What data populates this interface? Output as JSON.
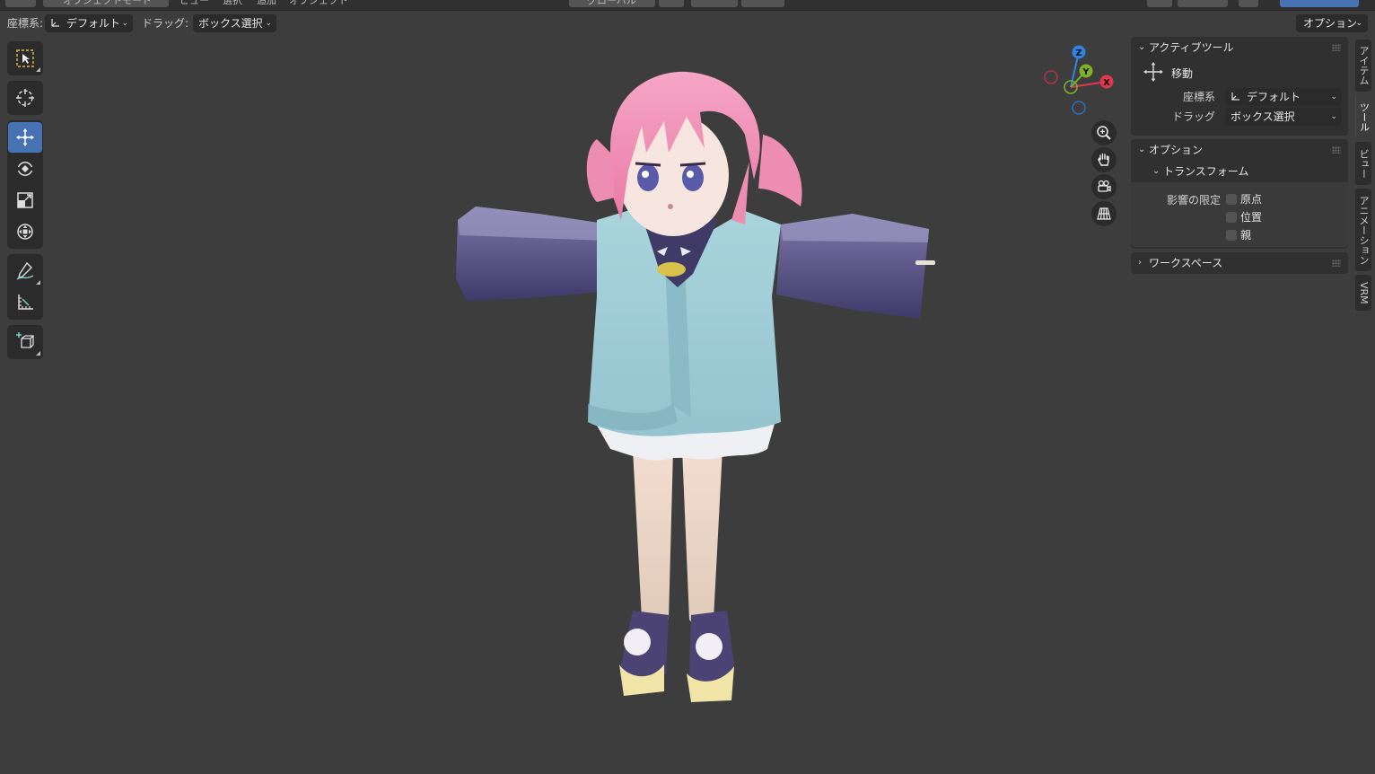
{
  "top_strip": {
    "mode_dropdown": "オブジェクトモード",
    "menu_view": "ビュー",
    "menu_select": "選択",
    "menu_add": "追加",
    "menu_object": "オブジェクト",
    "transform_orientation": "グローバル"
  },
  "tool_header": {
    "coord_label": "座標系:",
    "coord_value": "デフォルト",
    "drag_label": "ドラッグ:",
    "drag_value": "ボックス選択",
    "options_button": "オプション"
  },
  "toolbar": {
    "tools": [
      {
        "name": "select-box",
        "icon": "select-box-icon"
      },
      {
        "name": "cursor",
        "icon": "cursor-icon"
      },
      {
        "name": "move",
        "icon": "move-icon",
        "active": true
      },
      {
        "name": "rotate",
        "icon": "rotate-icon"
      },
      {
        "name": "scale",
        "icon": "scale-icon"
      },
      {
        "name": "transform",
        "icon": "transform-icon"
      },
      {
        "name": "annotate",
        "icon": "annotate-icon"
      },
      {
        "name": "measure",
        "icon": "measure-icon"
      },
      {
        "name": "add-cube",
        "icon": "add-cube-icon"
      }
    ]
  },
  "gizmo": {
    "x": "X",
    "y": "Y",
    "z": "Z",
    "colors": {
      "x": "#e0384e",
      "y": "#7fb127",
      "z": "#2f83e3"
    }
  },
  "nav_buttons": [
    "zoom-icon",
    "pan-hand-icon",
    "camera-icon",
    "perspective-grid-icon"
  ],
  "npanel": {
    "active_tool": {
      "header": "アクティブツール",
      "tool_name": "移動",
      "coord_label": "座標系",
      "coord_value": "デフォルト",
      "drag_label": "ドラッグ",
      "drag_value": "ボックス選択"
    },
    "options": {
      "header": "オプション",
      "transform_header": "トランスフォーム",
      "affect_only_label": "影響の限定",
      "affect_origins": "原点",
      "affect_locations": "位置",
      "affect_parents": "親"
    },
    "workspace": {
      "header": "ワークスペース"
    }
  },
  "side_tabs": [
    "アイテム",
    "ツール",
    "ビュー",
    "アニメーション",
    "VRM"
  ],
  "colors": {
    "viewport_bg": "#3d3d3d",
    "active_tool": "#4772b3",
    "panel_bg": "#303030"
  }
}
